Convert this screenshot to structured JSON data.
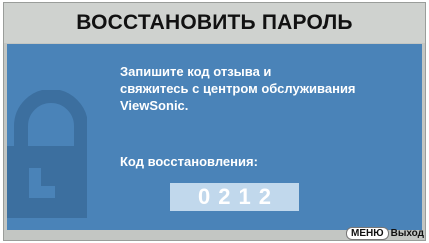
{
  "dialog": {
    "title": "ВОССТАНОВИТЬ ПАРОЛЬ",
    "message_lines": [
      "Запишите код отзыва и",
      "свяжитесь с центром обслуживания",
      "ViewSonic."
    ],
    "code_label": "Код восстановления:",
    "code_value": "0212"
  },
  "footer": {
    "menu_key": "МЕНЮ",
    "exit_label": "Выход"
  },
  "icons": [
    "lock-icon"
  ],
  "colors": {
    "panel": "#4a83b8",
    "frame": "#c3c6c3",
    "code_box": "#c1d8ec",
    "text_on_panel": "#ffffff"
  }
}
